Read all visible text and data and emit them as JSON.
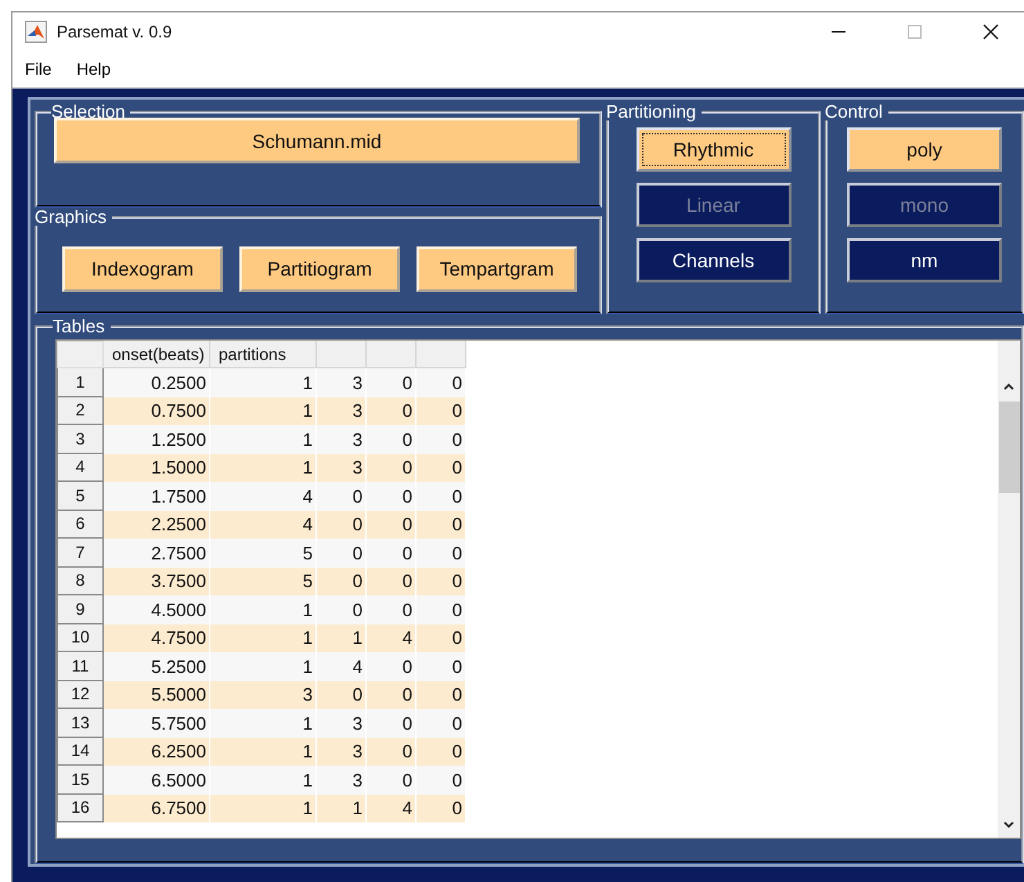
{
  "window": {
    "title": "Parsemat v. 0.9"
  },
  "menu": [
    "File",
    "Help"
  ],
  "selection": {
    "title": "Selection",
    "button": "Schumann.mid"
  },
  "graphics": {
    "title": "Graphics",
    "buttons": [
      "Indexogram",
      "Partitiogram",
      "Tempartgram"
    ]
  },
  "partitioning": {
    "title": "Partitioning",
    "buttons": [
      {
        "label": "Rhythmic",
        "selected": true,
        "disabled": false,
        "focused": true
      },
      {
        "label": "Linear",
        "selected": false,
        "disabled": true,
        "focused": false
      },
      {
        "label": "Channels",
        "selected": false,
        "disabled": false,
        "focused": false
      }
    ]
  },
  "control": {
    "title": "Control",
    "buttons": [
      {
        "label": "poly",
        "selected": true,
        "disabled": false,
        "focused": false
      },
      {
        "label": "mono",
        "selected": false,
        "disabled": true,
        "focused": false
      },
      {
        "label": "nm",
        "selected": false,
        "disabled": false,
        "focused": false
      }
    ]
  },
  "tables": {
    "title": "Tables",
    "columns": [
      "onset(beats)",
      "partitions"
    ],
    "rows": [
      {
        "index": "1",
        "cells": [
          "0.2500",
          "1",
          "3",
          "0",
          "0"
        ]
      },
      {
        "index": "2",
        "cells": [
          "0.7500",
          "1",
          "3",
          "0",
          "0"
        ]
      },
      {
        "index": "3",
        "cells": [
          "1.2500",
          "1",
          "3",
          "0",
          "0"
        ]
      },
      {
        "index": "4",
        "cells": [
          "1.5000",
          "1",
          "3",
          "0",
          "0"
        ]
      },
      {
        "index": "5",
        "cells": [
          "1.7500",
          "4",
          "0",
          "0",
          "0"
        ]
      },
      {
        "index": "6",
        "cells": [
          "2.2500",
          "4",
          "0",
          "0",
          "0"
        ]
      },
      {
        "index": "7",
        "cells": [
          "2.7500",
          "5",
          "0",
          "0",
          "0"
        ]
      },
      {
        "index": "8",
        "cells": [
          "3.7500",
          "5",
          "0",
          "0",
          "0"
        ]
      },
      {
        "index": "9",
        "cells": [
          "4.5000",
          "1",
          "0",
          "0",
          "0"
        ]
      },
      {
        "index": "10",
        "cells": [
          "4.7500",
          "1",
          "1",
          "4",
          "0"
        ]
      },
      {
        "index": "11",
        "cells": [
          "5.2500",
          "1",
          "4",
          "0",
          "0"
        ]
      },
      {
        "index": "12",
        "cells": [
          "5.5000",
          "3",
          "0",
          "0",
          "0"
        ]
      },
      {
        "index": "13",
        "cells": [
          "5.7500",
          "1",
          "3",
          "0",
          "0"
        ]
      },
      {
        "index": "14",
        "cells": [
          "6.2500",
          "1",
          "3",
          "0",
          "0"
        ]
      },
      {
        "index": "15",
        "cells": [
          "6.5000",
          "1",
          "3",
          "0",
          "0"
        ]
      },
      {
        "index": "16",
        "cells": [
          "6.7500",
          "1",
          "1",
          "4",
          "0"
        ]
      }
    ]
  }
}
